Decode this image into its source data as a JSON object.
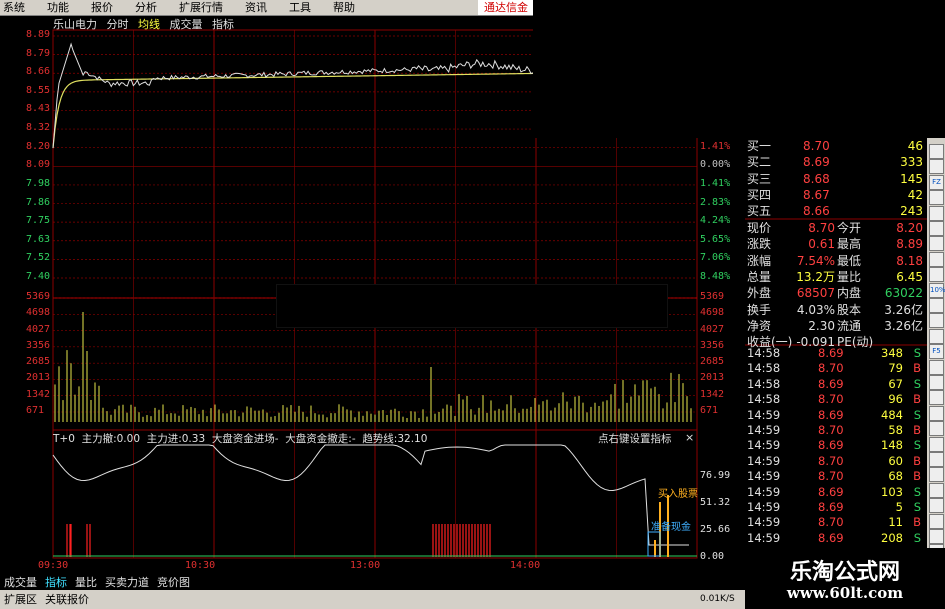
{
  "menu": [
    "系统",
    "功能",
    "报价",
    "分析",
    "扩展行情",
    "资讯",
    "工具",
    "帮助"
  ],
  "brand": "通达信金",
  "chart_head": {
    "stock": "乐山电力",
    "tabs": [
      "分时",
      "均线",
      "成交量",
      "指标"
    ]
  },
  "price_axis_left": [
    "8.89",
    "8.79",
    "8.66",
    "8.55",
    "8.43",
    "8.32",
    "8.20",
    "8.09",
    "7.98",
    "7.86",
    "7.75",
    "7.63",
    "7.52",
    "7.40"
  ],
  "price_axis_right": [
    "1.41%",
    "0.00%",
    "1.41%",
    "2.83%",
    "4.24%",
    "5.65%",
    "7.06%",
    "8.48%"
  ],
  "vol_axis": [
    "5369",
    "4698",
    "4027",
    "3356",
    "2685",
    "2013",
    "1342",
    "671"
  ],
  "ind_head": {
    "t0": "T+0",
    "a": "主力撤:0.00",
    "b": "主力进:0.33",
    "c": "大盘资金进场-",
    "d": "大盘资金撤走:-",
    "e": "趋势线:32.10",
    "right": "点右键设置指标",
    "close": "×"
  },
  "ind_axis": [
    "76.99",
    "51.32",
    "25.66",
    "0.00"
  ],
  "ind_notes": {
    "buy": "买入股票",
    "ready": "准备现金"
  },
  "time_axis": [
    "09:30",
    "10:30",
    "13:00",
    "14:00"
  ],
  "quote": {
    "bids": [
      {
        "k": "买一",
        "v": "8.70",
        "n": "46"
      },
      {
        "k": "买二",
        "v": "8.69",
        "n": "333"
      },
      {
        "k": "买三",
        "v": "8.68",
        "n": "145"
      },
      {
        "k": "买四",
        "v": "8.67",
        "n": "42"
      },
      {
        "k": "买五",
        "v": "8.66",
        "n": "243"
      }
    ],
    "stats": [
      {
        "k": "现价",
        "v": "8.70",
        "k2": "今开",
        "v2": "8.20"
      },
      {
        "k": "涨跌",
        "v": "0.61",
        "k2": "最高",
        "v2": "8.89"
      },
      {
        "k": "涨幅",
        "v": "7.54%",
        "k2": "最低",
        "v2": "8.18"
      },
      {
        "k": "总量",
        "v": "13.2万",
        "k2": "量比",
        "v2": "6.45"
      },
      {
        "k": "外盘",
        "v": "68507",
        "k2": "内盘",
        "v2": "63022"
      },
      {
        "k": "换手",
        "v": "4.03%",
        "k2": "股本",
        "v2": "3.26亿"
      },
      {
        "k": "净资",
        "v": "2.30",
        "k2": "流通",
        "v2": "3.26亿"
      },
      {
        "k": "收益(一)",
        "v": "-0.091",
        "k2": "PE(动)",
        "v2": ""
      }
    ]
  },
  "ticks": [
    {
      "t": "14:58",
      "p": "8.69",
      "q": "348",
      "s": "S"
    },
    {
      "t": "14:58",
      "p": "8.70",
      "q": "79",
      "s": "B"
    },
    {
      "t": "14:58",
      "p": "8.69",
      "q": "67",
      "s": "S"
    },
    {
      "t": "14:58",
      "p": "8.70",
      "q": "96",
      "s": "B"
    },
    {
      "t": "14:59",
      "p": "8.69",
      "q": "484",
      "s": "S"
    },
    {
      "t": "14:59",
      "p": "8.70",
      "q": "58",
      "s": "B"
    },
    {
      "t": "14:59",
      "p": "8.69",
      "q": "148",
      "s": "S"
    },
    {
      "t": "14:59",
      "p": "8.70",
      "q": "60",
      "s": "B"
    },
    {
      "t": "14:59",
      "p": "8.70",
      "q": "68",
      "s": "B"
    },
    {
      "t": "14:59",
      "p": "8.69",
      "q": "103",
      "s": "S"
    },
    {
      "t": "14:59",
      "p": "8.69",
      "q": "5",
      "s": "S"
    },
    {
      "t": "14:59",
      "p": "8.70",
      "q": "11",
      "s": "B"
    },
    {
      "t": "14:59",
      "p": "8.69",
      "q": "208",
      "s": "S"
    }
  ],
  "side_buttons": [
    "FZ",
    "10%",
    "F5"
  ],
  "bottom_tabs": [
    "成交量",
    "指标",
    "量比",
    "买卖力道",
    "竞价图"
  ],
  "status": [
    "扩展区",
    "关联报价"
  ],
  "speed": "0.01K/S",
  "watermark": {
    "l1": "乐淘公式网",
    "l2": "www.60lt.com"
  },
  "colors": {
    "up": "#ff4040",
    "down": "#30d060",
    "price_line": "#e0e0e0",
    "avg_line": "#e0e060",
    "grid": "#8b0000"
  }
}
